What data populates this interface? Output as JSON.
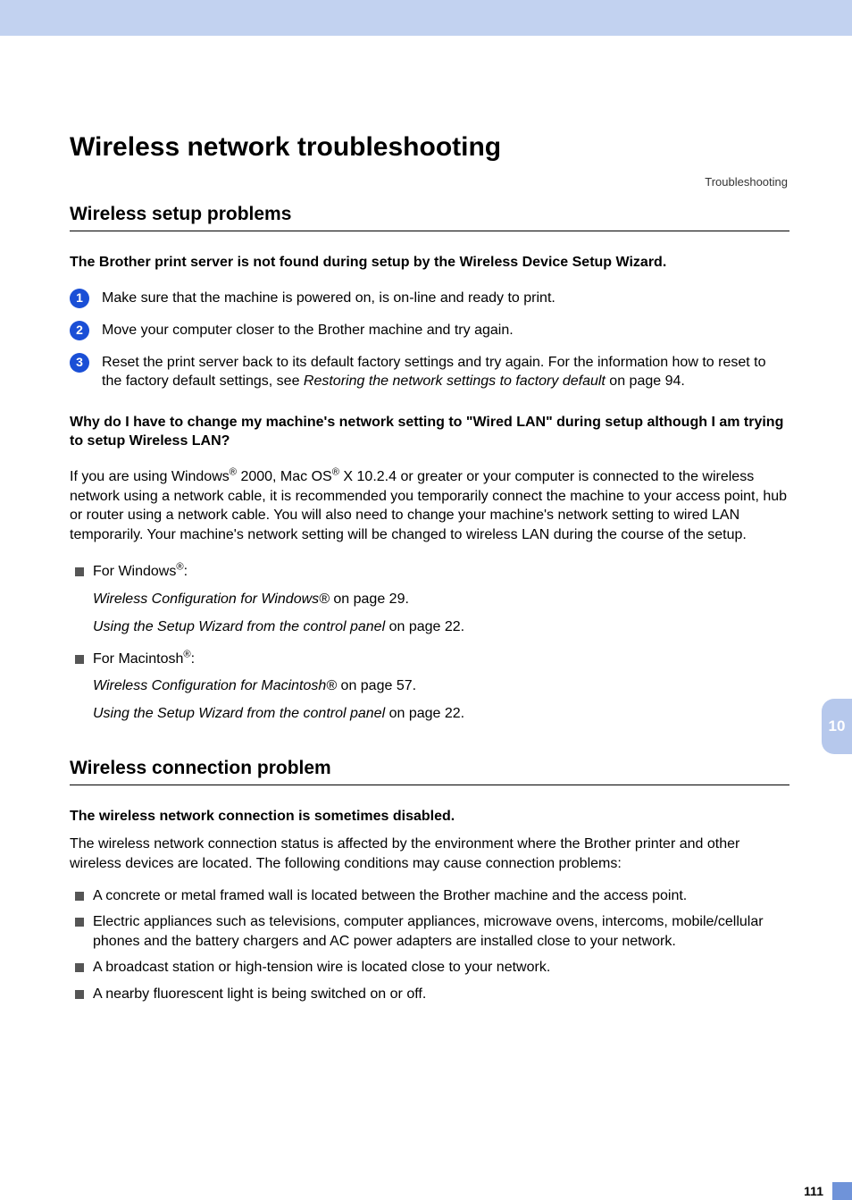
{
  "header_right": "Troubleshooting",
  "h1": "Wireless network troubleshooting",
  "h2_a": "Wireless setup problems",
  "bold_a": "The Brother print server is not found during setup by the Wireless Device Setup Wizard.",
  "steps": {
    "s1": "Make sure that the machine is powered on, is on-line and ready to print.",
    "s2": "Move your computer closer to the Brother machine and try again.",
    "s3_a": "Reset the print server back to its default factory settings and try again. For the information how to reset to the factory default settings, see ",
    "s3_link": "Restoring the network settings to factory default",
    "s3_b": " on page 94."
  },
  "bold_b": "Why do I have to change my machine's network setting to \"Wired LAN\" during setup although I am trying to setup Wireless LAN?",
  "para_b_1": "If you are using Windows",
  "para_b_2": " 2000, Mac OS",
  "para_b_3": " X 10.2.4 or greater or your computer is connected to the wireless network using a network cable, it is recommended you temporarily connect the machine to your access point, hub or router using a network cable. You will also need to change your machine's network setting to wired LAN temporarily. Your machine's network setting will be changed to wireless LAN during the course of the setup.",
  "win_label_a": "For Windows",
  "win_label_b": ":",
  "win_sub1_link": "Wireless Configuration for Windows®",
  "win_sub1_tail": " on page 29.",
  "win_sub2_link": "Using the Setup Wizard from the control panel",
  "win_sub2_tail": " on page 22.",
  "mac_label_a": "For Macintosh",
  "mac_label_b": ":",
  "mac_sub1_link": "Wireless Configuration for Macintosh®",
  "mac_sub1_tail": " on page 57.",
  "mac_sub2_link": "Using the Setup Wizard from the control panel",
  "mac_sub2_tail": " on page 22.",
  "h2_b": "Wireless connection problem",
  "bold_c": "The wireless network connection is sometimes disabled.",
  "para_c": "The wireless network connection status is affected by the environment where the Brother printer and other wireless devices are located. The following conditions may cause connection problems:",
  "bullets": {
    "b1": "A concrete or metal framed wall is located between the Brother machine and the access point.",
    "b2": "Electric appliances such as televisions, computer appliances, microwave ovens, intercoms, mobile/cellular phones and the battery chargers and AC power adapters are installed close to your network.",
    "b3": "A broadcast station or high-tension wire is located close to your network.",
    "b4": "A nearby fluorescent light is being switched on or off."
  },
  "side_tab": "10",
  "page_num": "111",
  "badges": {
    "n1": "1",
    "n2": "2",
    "n3": "3"
  },
  "reg": "®"
}
